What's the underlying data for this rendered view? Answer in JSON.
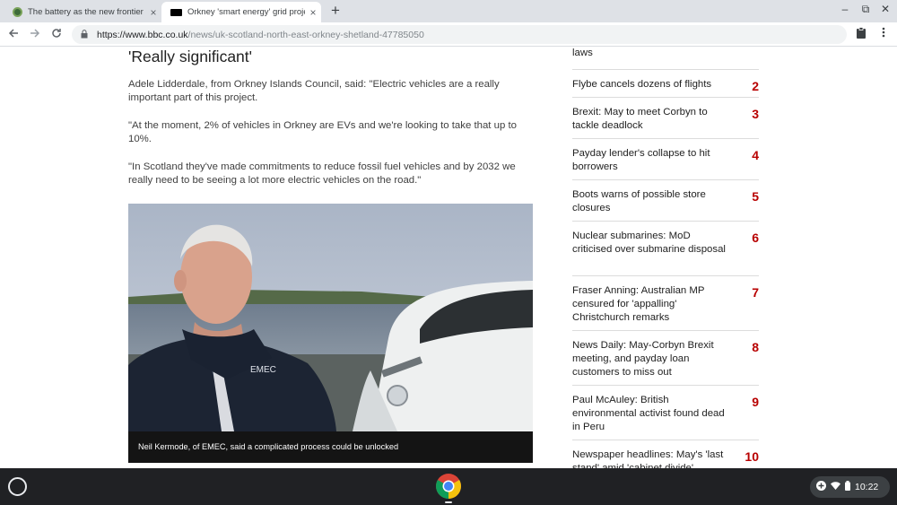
{
  "browser": {
    "tabs": [
      {
        "title": "The battery as the new frontier -"
      },
      {
        "title": "Orkney 'smart energy' grid projec"
      }
    ],
    "tab_close_glyph": "×",
    "new_tab_glyph": "+",
    "window_controls": [
      "–",
      "⧉",
      "✕"
    ],
    "url_host": "https://www.bbc.co.uk",
    "url_path": "/news/uk-scotland-north-east-orkney-shetland-47785050"
  },
  "article": {
    "crosshead": "'Really significant'",
    "paragraphs": [
      "Adele Lidderdale, from Orkney Islands Council, said: \"Electric vehicles are a really important part of this project.",
      "\"At the moment, 2% of vehicles in Orkney are EVs and we're looking to take that up to 10%.",
      "\"In Scotland they've made commitments to reduce fossil fuel vehicles and by 2032 we really need to be seeing a lot more electric vehicles on the road.\""
    ],
    "photo_logo_text": "EMEC",
    "caption": "Neil Kermode, of EMEC, said a complicated process could be unlocked"
  },
  "most_read": {
    "items": [
      {
        "title": "laws",
        "rank": ""
      },
      {
        "title": "Flybe cancels dozens of flights",
        "rank": "2"
      },
      {
        "title": "Brexit: May to meet Corbyn to tackle deadlock",
        "rank": "3"
      },
      {
        "title": "Payday lender's collapse to hit borrowers",
        "rank": "4"
      },
      {
        "title": "Boots warns of possible store closures",
        "rank": "5"
      },
      {
        "title": "Nuclear submarines: MoD criticised over submarine disposal",
        "rank": "6"
      },
      {
        "title": "Fraser Anning: Australian MP censured for 'appalling' Christchurch remarks",
        "rank": "7"
      },
      {
        "title": "News Daily: May-Corbyn Brexit meeting, and payday loan customers to miss out",
        "rank": "8"
      },
      {
        "title": "Paul McAuley: British environmental activist found dead in Peru",
        "rank": "9"
      },
      {
        "title": "Newspaper headlines: May's 'last stand' amid 'cabinet divide'",
        "rank": "10"
      }
    ]
  },
  "system_tray": {
    "time": "10:22"
  },
  "colors": {
    "rank_red": "#b80000",
    "tab_strip": "#dee1e6",
    "shelf": "#202124"
  }
}
